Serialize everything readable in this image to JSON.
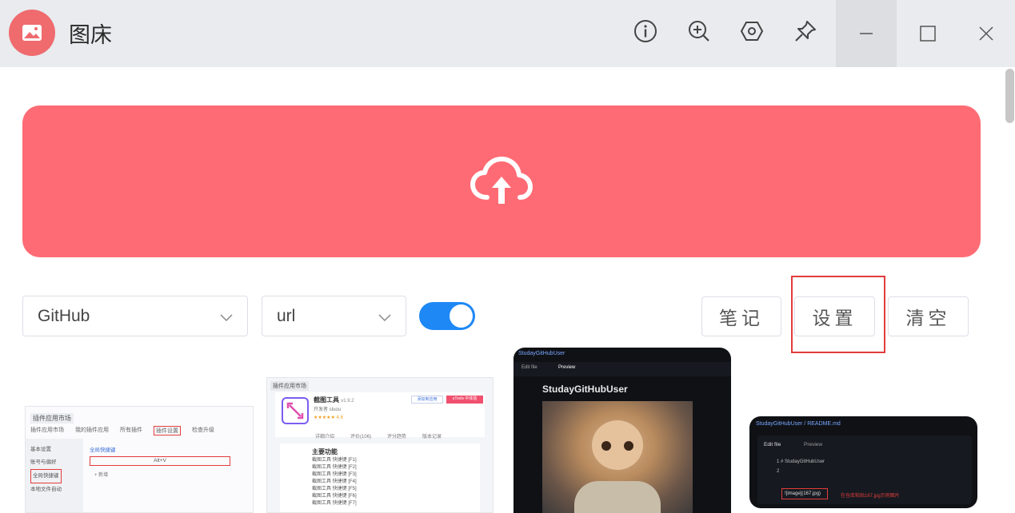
{
  "app": {
    "title": "图床"
  },
  "window_controls": {
    "minimize": "minimize-icon",
    "maximize": "maximize-icon",
    "close": "close-icon"
  },
  "toolbar_icons": [
    "info-icon",
    "zoom-in-icon",
    "settings-hex-icon",
    "pin-icon"
  ],
  "upload": {
    "icon": "cloud-upload-icon",
    "color": "#ff6b74"
  },
  "controls": {
    "host_select": {
      "value": "GitHub"
    },
    "format_select": {
      "value": "url"
    },
    "toggle_on": true,
    "notes_label": "笔记",
    "settings_label": "设置",
    "clear_label": "清空",
    "accent": "#1e88f5",
    "highlight_color": "#e23c3c"
  },
  "thumbnails": {
    "t1": {
      "header": "插件应用市场",
      "tabs": [
        "插件应用市场",
        "我的插件应用",
        "所有插件",
        "插件设置",
        "检查升级"
      ],
      "sidebar": [
        "基本设置",
        "账号与偏好",
        "全局快捷键",
        "本地文件自动"
      ],
      "label": "全局快捷键",
      "shortcut": "Alt+V",
      "add": "+ 新增"
    },
    "t2": {
      "header": "插件应用市场",
      "name": "截图工具",
      "version": "v1.9.2",
      "author": "开发者 sluou",
      "rating": "★★★★★ 4.6",
      "btn_a": "添加到应用",
      "btn_b": "uTools 中体验",
      "tabs": [
        "详细介绍",
        "评价(106)",
        "评分趋势",
        "版本记录"
      ],
      "body_title": "主要功能",
      "body_lines": [
        "截图工具 快捷键 [F1]",
        "截图工具 快捷键 [F2]",
        "截图工具 快捷键 [F3]",
        "截图工具 快捷键 [F4]",
        "截图工具 快捷键 [F5]",
        "截图工具 快捷键 [F6]",
        "截图工具 快捷键 [F7]"
      ]
    },
    "t3": {
      "repo": "StudayGitHubUser",
      "tab_edit": "Edit file",
      "tab_preview": "Preview",
      "title": "StudayGitHubUser"
    },
    "t4": {
      "repo": "StudayGitHubUser / README.md",
      "tab_edit": "Edit file",
      "tab_preview": "Preview",
      "line1": "1  # StudayGitHubUser",
      "line2": "2",
      "code": "![image](167.jpg)",
      "note": "在仓库粘贴167.jpg示例图片"
    }
  }
}
